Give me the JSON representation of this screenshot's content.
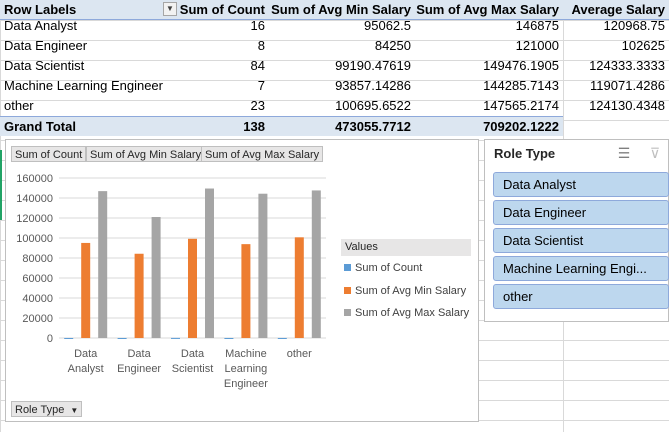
{
  "pivot": {
    "headers": [
      "Row Labels",
      "Sum of Count",
      "Sum of Avg Min Salary",
      "Sum of Avg Max Salary",
      "Average Salary"
    ],
    "rows": [
      {
        "label": "Data Analyst",
        "count": "16",
        "min": "95062.5",
        "max": "146875",
        "avg": "120968.75"
      },
      {
        "label": "Data Engineer",
        "count": "8",
        "min": "84250",
        "max": "121000",
        "avg": "102625"
      },
      {
        "label": "Data Scientist",
        "count": "84",
        "min": "99190.47619",
        "max": "149476.1905",
        "avg": "124333.3333"
      },
      {
        "label": "Machine Learning Engineer",
        "count": "7",
        "min": "93857.14286",
        "max": "144285.7143",
        "avg": "119071.4286"
      },
      {
        "label": "other",
        "count": "23",
        "min": "100695.6522",
        "max": "147565.2174",
        "avg": "124130.4348"
      }
    ],
    "total": {
      "label": "Grand Total",
      "count": "138",
      "min": "473055.7712",
      "max": "709202.1222"
    }
  },
  "chart_buttons": {
    "count": "Sum of Count",
    "min": "Sum of Avg Min Salary",
    "max": "Sum of Avg Max Salary",
    "axis_field": "Role Type"
  },
  "chart_data": {
    "type": "bar",
    "categories": [
      "Data Analyst",
      "Data Engineer",
      "Data Scientist",
      "Machine Learning Engineer",
      "other"
    ],
    "category_lines": [
      [
        "Data",
        "Analyst"
      ],
      [
        "Data",
        "Engineer"
      ],
      [
        "Data",
        "Scientist"
      ],
      [
        "Machine",
        "Learning",
        "Engineer"
      ],
      [
        "other"
      ]
    ],
    "series": [
      {
        "name": "Sum of Count",
        "values": [
          16,
          8,
          84,
          7,
          23
        ],
        "color": "#5b9bd5"
      },
      {
        "name": "Sum of Avg Min Salary",
        "values": [
          95062.5,
          84250,
          99190.48,
          93857.14,
          100695.65
        ],
        "color": "#ed7d31"
      },
      {
        "name": "Sum of Avg Max Salary",
        "values": [
          146875,
          121000,
          149476.19,
          144285.71,
          147565.22
        ],
        "color": "#a5a5a5"
      }
    ],
    "yticks": [
      "0",
      "20000",
      "40000",
      "60000",
      "80000",
      "100000",
      "120000",
      "140000",
      "160000"
    ],
    "ylim": [
      0,
      160000
    ],
    "legend_title": "Values",
    "legend_position": "right",
    "grid": true
  },
  "slicer": {
    "title": "Role Type",
    "items": [
      "Data Analyst",
      "Data Engineer",
      "Data Scientist",
      "Machine Learning Engi...",
      "other"
    ]
  }
}
